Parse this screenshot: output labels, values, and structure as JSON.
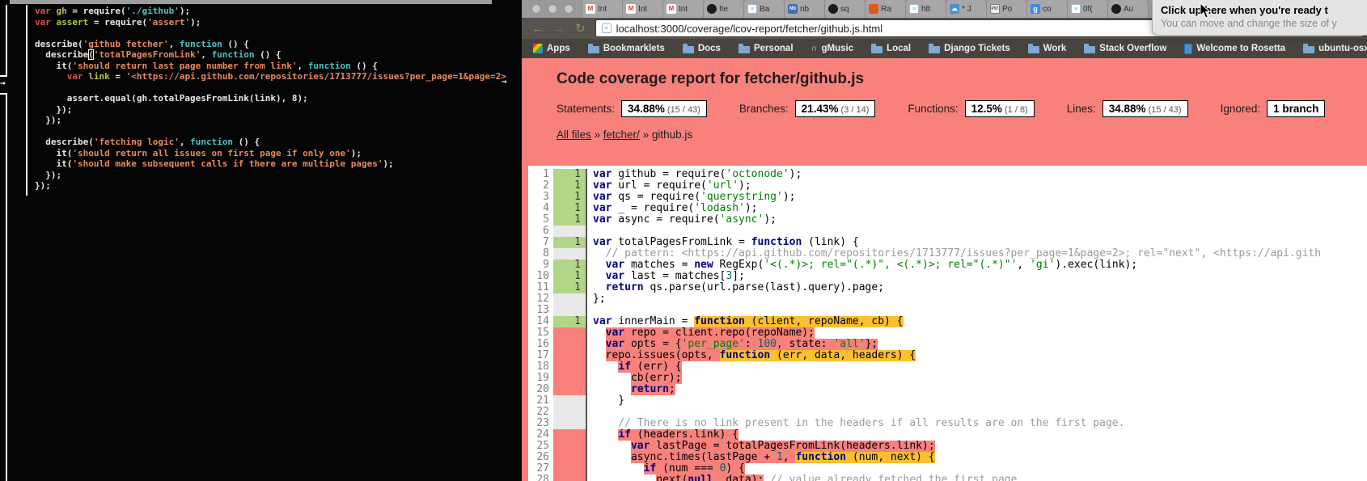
{
  "terminal": {
    "fringe_arrow": "→",
    "truncation_arrow": "→",
    "lines": [
      {
        "segs": [
          [
            "k",
            "var "
          ],
          [
            "v",
            "gh "
          ],
          [
            "p",
            "= require("
          ],
          [
            "s2",
            "'./github'"
          ],
          [
            "p",
            ");"
          ]
        ]
      },
      {
        "segs": [
          [
            "k",
            "var "
          ],
          [
            "v",
            "assert "
          ],
          [
            "p",
            "= require("
          ],
          [
            "s",
            "'assert'"
          ],
          [
            "p",
            ");"
          ]
        ]
      },
      {
        "segs": []
      },
      {
        "segs": [
          [
            "p",
            "describe("
          ],
          [
            "s",
            "'github fetcher'"
          ],
          [
            "p",
            ", "
          ],
          [
            "f",
            "function"
          ],
          [
            "p",
            " () {"
          ]
        ]
      },
      {
        "segs": [
          [
            "p",
            "  describe"
          ],
          [
            "cur",
            "("
          ],
          [
            "s",
            "'totalPagesFromLink'"
          ],
          [
            "p",
            ", "
          ],
          [
            "f",
            "function"
          ],
          [
            "p",
            " () {"
          ]
        ]
      },
      {
        "segs": [
          [
            "p",
            "    it("
          ],
          [
            "s",
            "'should return last page number from link'"
          ],
          [
            "p",
            ", "
          ],
          [
            "f",
            "function"
          ],
          [
            "p",
            " () {"
          ]
        ]
      },
      {
        "segs": [
          [
            "p",
            "      "
          ],
          [
            "k",
            "var "
          ],
          [
            "v",
            "link "
          ],
          [
            "p",
            "= "
          ],
          [
            "s",
            "'<https://api.github.com/repositories/1713777/issues?per_page=1&page=2>"
          ]
        ]
      },
      {
        "segs": []
      },
      {
        "segs": [
          [
            "p",
            "      assert.equal(gh.totalPagesFromLink(link), 8);"
          ]
        ]
      },
      {
        "segs": [
          [
            "p",
            "    });"
          ]
        ]
      },
      {
        "segs": [
          [
            "p",
            "  });"
          ]
        ]
      },
      {
        "segs": []
      },
      {
        "segs": [
          [
            "p",
            "  describe("
          ],
          [
            "s",
            "'fetching logic'"
          ],
          [
            "p",
            ", "
          ],
          [
            "f",
            "function"
          ],
          [
            "p",
            " () {"
          ]
        ]
      },
      {
        "segs": [
          [
            "p",
            "    it("
          ],
          [
            "s",
            "'should return all issues on first page if only one'"
          ],
          [
            "p",
            ");"
          ]
        ]
      },
      {
        "segs": [
          [
            "p",
            "    it("
          ],
          [
            "s",
            "'should make subsequent calls if there are multiple pages'"
          ],
          [
            "p",
            ");"
          ]
        ]
      },
      {
        "segs": [
          [
            "p",
            "  });"
          ]
        ]
      },
      {
        "segs": [
          [
            "p",
            "});"
          ]
        ]
      }
    ]
  },
  "browser": {
    "icon_glyphs": {
      "gmail": "M",
      "github": "",
      "page": "≡",
      "nb": "Nb",
      "rabbit": "",
      "cloud": "☁",
      "p97": "P97",
      "google": "g",
      "apps": "",
      "folder": "",
      "music": "∩",
      "rosetta": ""
    },
    "tabs": [
      {
        "icon": "gmail",
        "label": "Int"
      },
      {
        "icon": "gmail",
        "label": "Int"
      },
      {
        "icon": "gmail",
        "label": "Int"
      },
      {
        "icon": "github",
        "label": "Ite"
      },
      {
        "icon": "page",
        "label": "Ba"
      },
      {
        "icon": "nb",
        "label": "nb"
      },
      {
        "icon": "github",
        "label": "sq"
      },
      {
        "icon": "rabbit",
        "label": "Ra"
      },
      {
        "icon": "page",
        "label": "htt"
      },
      {
        "icon": "cloud",
        "label": "* J"
      },
      {
        "icon": "p97",
        "label": "Po"
      },
      {
        "icon": "google",
        "label": "co"
      },
      {
        "icon": "page",
        "label": "0f("
      },
      {
        "icon": "github",
        "label": "Au"
      },
      {
        "icon": "github",
        "label": ""
      }
    ],
    "toolbar": {
      "back_icon": "←",
      "forward_icon": "→",
      "reload_icon": "↻",
      "url": "localhost:3000/coverage/lcov-report/fetcher/github.js.html"
    },
    "bookmarks": [
      {
        "icon": "apps",
        "label": "Apps"
      },
      {
        "icon": "folder",
        "label": "Bookmarklets"
      },
      {
        "icon": "folder",
        "label": "Docs"
      },
      {
        "icon": "folder",
        "label": "Personal"
      },
      {
        "icon": "music",
        "label": "gMusic"
      },
      {
        "icon": "folder",
        "label": "Local"
      },
      {
        "icon": "folder",
        "label": "Django Tickets"
      },
      {
        "icon": "folder",
        "label": "Work"
      },
      {
        "icon": "folder",
        "label": "Stack Overflow"
      },
      {
        "icon": "rosetta",
        "label": "Welcome to Rosetta"
      },
      {
        "icon": "folder",
        "label": "ubuntu-osx-inst"
      }
    ],
    "tooltip": {
      "line1": "Click up here when you're ready t",
      "line2": "You can move and change the size of y"
    }
  },
  "report": {
    "title_prefix": "Code coverage report for ",
    "title_file": "fetcher/github.js",
    "metrics": [
      {
        "label": "Statements:",
        "value": "34.88%",
        "fraction": "(15 / 43)"
      },
      {
        "label": "Branches:",
        "value": "21.43%",
        "fraction": "(3 / 14)"
      },
      {
        "label": "Functions:",
        "value": "12.5%",
        "fraction": "(1 / 8)"
      },
      {
        "label": "Lines:",
        "value": "34.88%",
        "fraction": "(15 / 43)"
      },
      {
        "label": "Ignored:",
        "value": "1 branch",
        "fraction": ""
      }
    ],
    "breadcrumb": {
      "separator": "»",
      "parts": [
        {
          "text": "All files",
          "link": true
        },
        {
          "text": "fetcher/",
          "link": true
        },
        {
          "text": "github.js",
          "link": false
        }
      ]
    },
    "colors": {
      "coverage_low_bg": "#f8817c",
      "missed_function_bg": "#fcbf2e",
      "covered_gutter": "#b2d687",
      "neutral_gutter": "#e9e9e9"
    },
    "lines": [
      {
        "n": 1,
        "g": "yes",
        "c": "1",
        "s": [
          [
            "k",
            "var"
          ],
          [
            "p",
            " github = require("
          ],
          [
            "s",
            "'octonode'"
          ],
          [
            "p",
            ");"
          ]
        ]
      },
      {
        "n": 2,
        "g": "yes",
        "c": "1",
        "s": [
          [
            "k",
            "var"
          ],
          [
            "p",
            " url = require("
          ],
          [
            "s",
            "'url'"
          ],
          [
            "p",
            ");"
          ]
        ]
      },
      {
        "n": 3,
        "g": "yes",
        "c": "1",
        "s": [
          [
            "k",
            "var"
          ],
          [
            "p",
            " qs = require("
          ],
          [
            "s",
            "'querystring'"
          ],
          [
            "p",
            ");"
          ]
        ]
      },
      {
        "n": 4,
        "g": "yes",
        "c": "1",
        "s": [
          [
            "k",
            "var"
          ],
          [
            "p",
            " _ = require("
          ],
          [
            "s",
            "'lodash'"
          ],
          [
            "p",
            ");"
          ]
        ]
      },
      {
        "n": 5,
        "g": "yes",
        "c": "1",
        "s": [
          [
            "k",
            "var"
          ],
          [
            "p",
            " async = require("
          ],
          [
            "s",
            "'async'"
          ],
          [
            "p",
            ");"
          ]
        ]
      },
      {
        "n": 6,
        "g": "neutral",
        "c": "",
        "s": []
      },
      {
        "n": 7,
        "g": "yes",
        "c": "1",
        "s": [
          [
            "k",
            "var"
          ],
          [
            "p",
            " totalPagesFromLink = "
          ],
          [
            "k",
            "function"
          ],
          [
            "p",
            " (link) {"
          ]
        ]
      },
      {
        "n": 8,
        "g": "neutral",
        "c": "",
        "s": [
          [
            "c",
            "  // pattern: <https://api.github.com/repositories/1713777/issues?per_page=1&page=2>; rel=\"next\", <https://api.gith"
          ]
        ]
      },
      {
        "n": 9,
        "g": "yes",
        "c": "1",
        "s": [
          [
            "p",
            "  "
          ],
          [
            "k",
            "var"
          ],
          [
            "p",
            " matches = "
          ],
          [
            "k",
            "new"
          ],
          [
            "p",
            " RegExp("
          ],
          [
            "s",
            "'<(.*)>; rel=\"(.*)\", <(.*)>; rel=\"(.*)\"'"
          ],
          [
            "p",
            ", "
          ],
          [
            "s",
            "'gi'"
          ],
          [
            "p",
            ").exec(link);"
          ]
        ]
      },
      {
        "n": 10,
        "g": "yes",
        "c": "1",
        "s": [
          [
            "p",
            "  "
          ],
          [
            "k",
            "var"
          ],
          [
            "p",
            " last = matches["
          ],
          [
            "l",
            "3"
          ],
          [
            "p",
            "];"
          ]
        ]
      },
      {
        "n": 11,
        "g": "yes",
        "c": "1",
        "s": [
          [
            "p",
            "  "
          ],
          [
            "k",
            "return"
          ],
          [
            "p",
            " qs.parse(url.parse(last).query).page;"
          ]
        ]
      },
      {
        "n": 12,
        "g": "neutral",
        "c": "",
        "s": [
          [
            "p",
            "};"
          ]
        ]
      },
      {
        "n": 13,
        "g": "neutral",
        "c": "",
        "s": []
      },
      {
        "n": 14,
        "g": "yes",
        "c": "1",
        "s": [
          [
            "k",
            "var"
          ],
          [
            "p",
            " innerMain = "
          ],
          [
            "k",
            "function",
            "Y"
          ],
          [
            "p",
            " (client, repoName, cb) {",
            "Y"
          ]
        ]
      },
      {
        "n": 15,
        "g": "no",
        "c": "",
        "s": [
          [
            "p",
            "  "
          ],
          [
            "k",
            "var",
            "P"
          ],
          [
            "p",
            " repo = client.repo(repoName);",
            "P"
          ]
        ]
      },
      {
        "n": 16,
        "g": "no",
        "c": "",
        "s": [
          [
            "p",
            "  "
          ],
          [
            "k",
            "var",
            "P"
          ],
          [
            "p",
            " opts = {",
            "P"
          ],
          [
            "s",
            "'per_page'",
            "P"
          ],
          [
            "p",
            ": ",
            "P"
          ],
          [
            "l",
            "100",
            "P"
          ],
          [
            "p",
            ", state: ",
            "P"
          ],
          [
            "s",
            "'all'",
            "P"
          ],
          [
            "p",
            "};",
            "P"
          ]
        ]
      },
      {
        "n": 17,
        "g": "no",
        "c": "",
        "s": [
          [
            "p",
            "  "
          ],
          [
            "p",
            "repo.issues(opts, ",
            "P"
          ],
          [
            "k",
            "function",
            "Y"
          ],
          [
            "p",
            " (err, data, headers) {",
            "Y"
          ]
        ]
      },
      {
        "n": 18,
        "g": "no",
        "c": "",
        "s": [
          [
            "p",
            "    "
          ],
          [
            "k",
            "if",
            "P"
          ],
          [
            "p",
            " (err) {",
            "P"
          ]
        ]
      },
      {
        "n": 19,
        "g": "no",
        "c": "",
        "s": [
          [
            "p",
            "      "
          ],
          [
            "p",
            "cb(err);",
            "P"
          ]
        ]
      },
      {
        "n": 20,
        "g": "no",
        "c": "",
        "s": [
          [
            "p",
            "      "
          ],
          [
            "k",
            "return",
            "P"
          ],
          [
            "p",
            ";",
            "P"
          ]
        ]
      },
      {
        "n": 21,
        "g": "neutral",
        "c": "",
        "s": [
          [
            "p",
            "    }"
          ]
        ]
      },
      {
        "n": 22,
        "g": "neutral",
        "c": "",
        "s": []
      },
      {
        "n": 23,
        "g": "neutral",
        "c": "",
        "s": [
          [
            "c",
            "    // There is no link present in the headers if all results are on the first page."
          ]
        ]
      },
      {
        "n": 24,
        "g": "no",
        "c": "",
        "s": [
          [
            "p",
            "    "
          ],
          [
            "k",
            "if",
            "P"
          ],
          [
            "p",
            " (headers.link) {",
            "P"
          ]
        ]
      },
      {
        "n": 25,
        "g": "no",
        "c": "",
        "s": [
          [
            "p",
            "      "
          ],
          [
            "k",
            "var",
            "P"
          ],
          [
            "p",
            " lastPage = totalPagesFromLink(headers.link);",
            "P"
          ]
        ]
      },
      {
        "n": 26,
        "g": "no",
        "c": "",
        "s": [
          [
            "p",
            "      "
          ],
          [
            "p",
            "async.times(lastPage + ",
            "P"
          ],
          [
            "l",
            "1",
            "P"
          ],
          [
            "p",
            ", ",
            "P"
          ],
          [
            "k",
            "function",
            "Y"
          ],
          [
            "p",
            " (num, next) {",
            "Y"
          ]
        ]
      },
      {
        "n": 27,
        "g": "no",
        "c": "",
        "s": [
          [
            "p",
            "        "
          ],
          [
            "k",
            "if",
            "P"
          ],
          [
            "p",
            " (num === ",
            "P"
          ],
          [
            "l",
            "0",
            "P"
          ],
          [
            "p",
            ") {",
            "P"
          ]
        ]
      },
      {
        "n": 28,
        "g": "no",
        "c": "",
        "s": [
          [
            "p",
            "          "
          ],
          [
            "p",
            "next(",
            "P"
          ],
          [
            "k",
            "null",
            "P"
          ],
          [
            "p",
            ", data);",
            "P"
          ],
          [
            "c",
            " // value already fetched the first page"
          ]
        ]
      }
    ]
  }
}
